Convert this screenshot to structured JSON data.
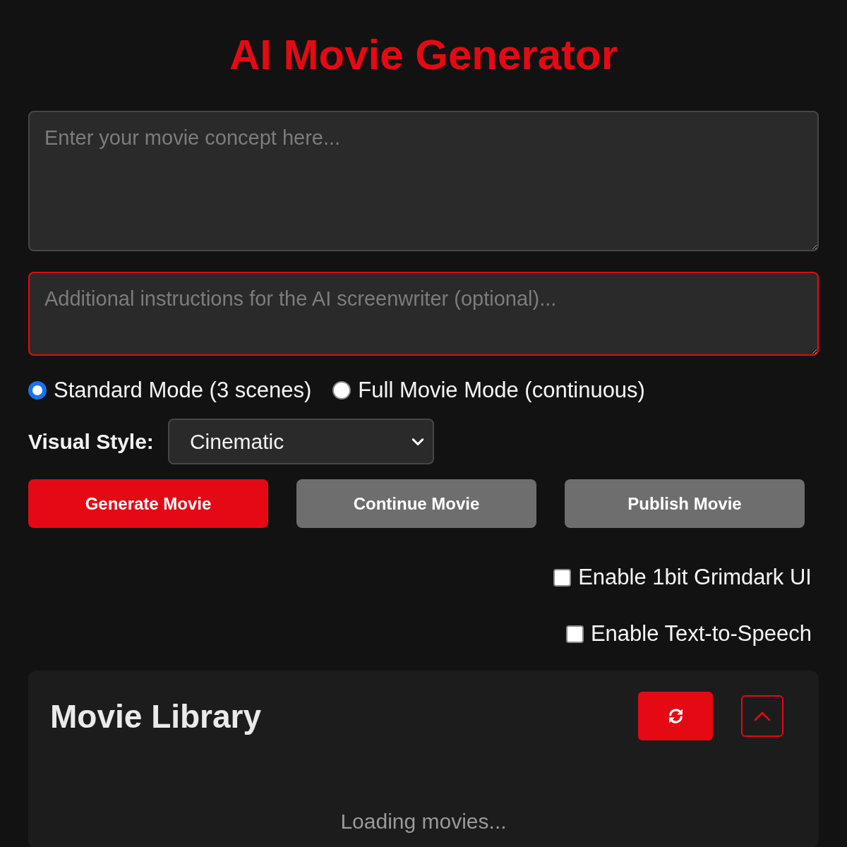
{
  "title": "AI Movie Generator",
  "concept_field": {
    "placeholder": "Enter your movie concept here..."
  },
  "instructions_field": {
    "placeholder": "Additional instructions for the AI screenwriter (optional)...",
    "focused": true
  },
  "modes": [
    {
      "label": "Standard Mode (3 scenes)",
      "selected": true
    },
    {
      "label": "Full Movie Mode (continuous)",
      "selected": false
    }
  ],
  "visual_style": {
    "label": "Visual Style:",
    "value": "Cinematic"
  },
  "buttons": [
    {
      "label": "Generate Movie",
      "kind": "primary"
    },
    {
      "label": "Continue Movie",
      "kind": "secondary"
    },
    {
      "label": "Publish Movie",
      "kind": "secondary"
    }
  ],
  "toggles": [
    {
      "label": "Enable 1bit Grimdark UI",
      "checked": false
    },
    {
      "label": "Enable Text-to-Speech",
      "checked": false
    }
  ],
  "library": {
    "title": "Movie Library",
    "expanded": true,
    "status": "Loading movies..."
  }
}
